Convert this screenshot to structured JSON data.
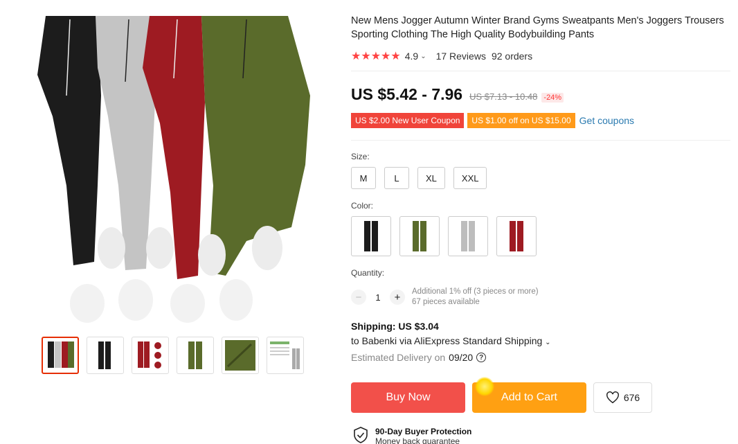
{
  "product": {
    "title": "New Mens Jogger Autumn Winter Brand Gyms Sweatpants Men's Joggers Trousers Sporting Clothing The High Quality Bodybuilding Pants",
    "rating": "4.9",
    "reviews": "17 Reviews",
    "orders": "92 orders",
    "price": "US $5.42 - 7.96",
    "old_price": "US $7.13 - 10.48",
    "discount": "-24%"
  },
  "coupons": {
    "new_user": "US $2.00 New User Coupon",
    "offer": "US $1.00 off on US $15.00",
    "get_link": "Get coupons"
  },
  "size": {
    "label": "Size:",
    "options": [
      "M",
      "L",
      "XL",
      "XXL"
    ]
  },
  "color": {
    "label": "Color:",
    "options": [
      "black",
      "army green",
      "gray",
      "red"
    ],
    "swatches": [
      "#1c1c1c",
      "#5a6b2b",
      "#bdbdbd",
      "#9e1b22"
    ]
  },
  "quantity": {
    "label": "Quantity:",
    "value": "1",
    "note_line1": "Additional 1% off (3 pieces or more)",
    "note_line2": "67 pieces available"
  },
  "shipping": {
    "label": "Shipping: US $3.04",
    "to": "to Babenki via AliExpress Standard Shipping",
    "est_label": "Estimated Delivery on",
    "est_date": "09/20"
  },
  "actions": {
    "buy_now": "Buy Now",
    "add_to_cart": "Add to Cart",
    "wish_count": "676"
  },
  "protection": {
    "title": "90-Day Buyer Protection",
    "subtitle": "Money back guarantee"
  },
  "colors": {
    "accent_red": "#f2504a",
    "accent_orange": "#ffa012",
    "link_blue": "#2a7ab0",
    "star_red": "#f44"
  }
}
